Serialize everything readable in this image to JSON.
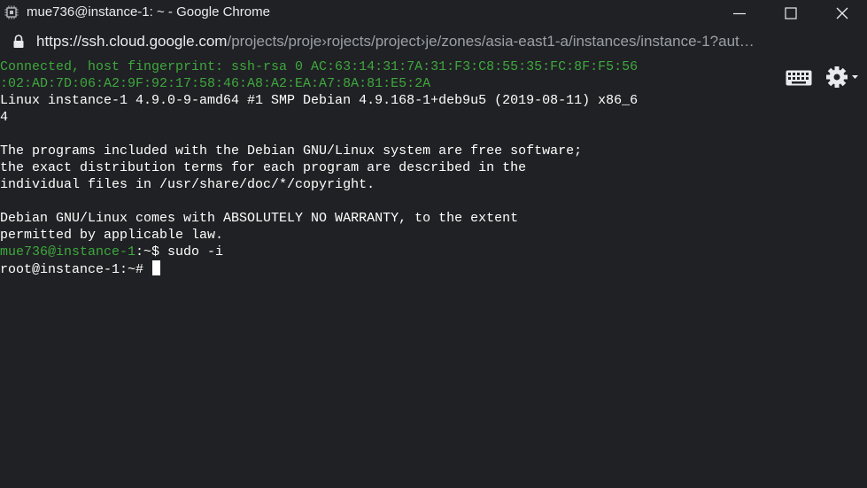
{
  "window": {
    "title": "mue736@instance-1: ~ - Google Chrome",
    "app_icon": "chip-icon",
    "controls": [
      "minimize-icon",
      "maximize-icon",
      "close-icon"
    ]
  },
  "urlbar": {
    "scheme": "https://",
    "host": "ssh.cloud.google.com",
    "path": "/projects/proje›rojects/project›je/zones/asia-east1-a/instances/instance-1?aut…",
    "lock_icon": "lock-icon"
  },
  "terminal": {
    "lines": [
      {
        "segments": [
          {
            "text": "Connected, host fingerprint: ssh-rsa 0 AC:63:14:31:7A:31:F3:C8:55:35:FC:8F:F5:56",
            "color": "green"
          }
        ]
      },
      {
        "segments": [
          {
            "text": ":02:AD:7D:06:A2:9F:92:17:58:46:A8:A2:EA:A7:8A:81:E5:2A",
            "color": "green"
          }
        ]
      },
      {
        "segments": [
          {
            "text": "Linux instance-1 4.9.0-9-amd64 #1 SMP Debian 4.9.168-1+deb9u5 (2019-08-11) x86_6",
            "color": "white"
          }
        ]
      },
      {
        "segments": [
          {
            "text": "4",
            "color": "white"
          }
        ]
      },
      {
        "segments": [
          {
            "text": "",
            "color": "white"
          }
        ]
      },
      {
        "segments": [
          {
            "text": "The programs included with the Debian GNU/Linux system are free software;",
            "color": "white"
          }
        ]
      },
      {
        "segments": [
          {
            "text": "the exact distribution terms for each program are described in the",
            "color": "white"
          }
        ]
      },
      {
        "segments": [
          {
            "text": "individual files in /usr/share/doc/*/copyright.",
            "color": "white"
          }
        ]
      },
      {
        "segments": [
          {
            "text": "",
            "color": "white"
          }
        ]
      },
      {
        "segments": [
          {
            "text": "Debian GNU/Linux comes with ABSOLUTELY NO WARRANTY, to the extent",
            "color": "white"
          }
        ]
      },
      {
        "segments": [
          {
            "text": "permitted by applicable law.",
            "color": "white"
          }
        ]
      },
      {
        "segments": [
          {
            "text": "mue736@instance-1",
            "color": "green"
          },
          {
            "text": ":~$ sudo -i",
            "color": "white"
          }
        ]
      },
      {
        "segments": [
          {
            "text": "root@instance-1:~# ",
            "color": "white"
          }
        ],
        "cursor": true
      }
    ],
    "toolbar": {
      "keyboard_icon": "keyboard-icon",
      "settings_icon": "gear-icon"
    }
  },
  "colors": {
    "background": "#202124",
    "prompt_green": "#3ea83e",
    "text": "#ffffff"
  }
}
